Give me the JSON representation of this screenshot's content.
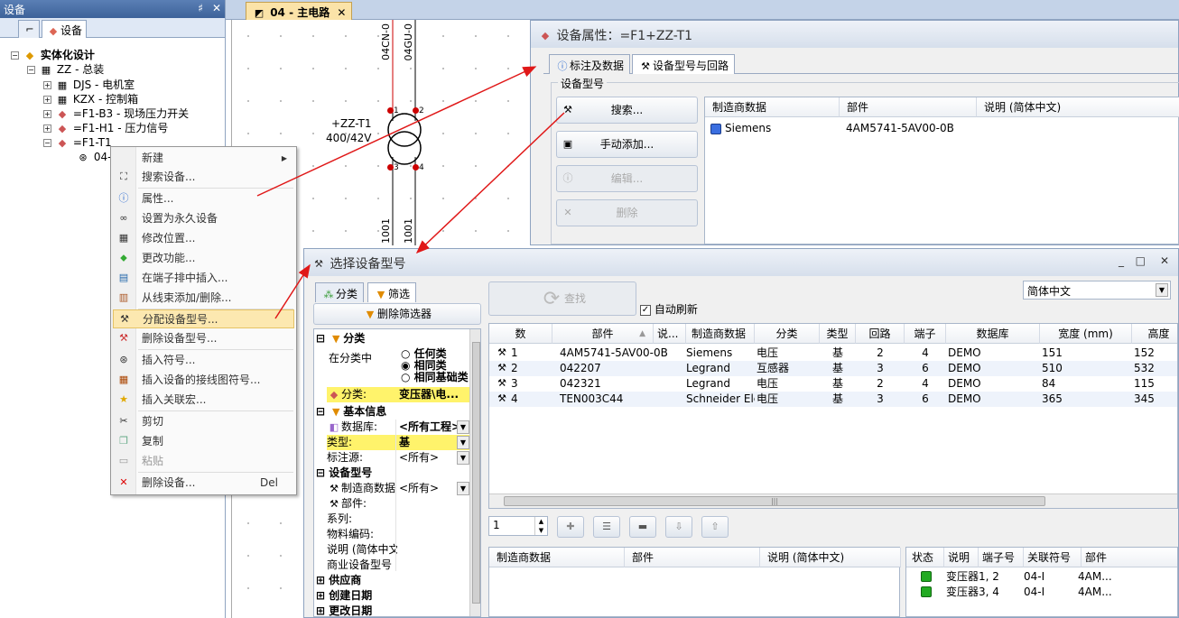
{
  "device_panel": {
    "title": "设备",
    "pin": "♯",
    "close": "✕",
    "tab_label": "设备",
    "tree": [
      {
        "label": "实体化设计",
        "bold": true
      },
      {
        "label": "ZZ - 总装"
      },
      {
        "label": "DJS - 电机室"
      },
      {
        "label": "KZX - 控制箱"
      },
      {
        "label": "=F1-B3 - 现场压力开关"
      },
      {
        "label": "=F1-H1 - 压力信号"
      },
      {
        "label": "=F1-T1"
      },
      {
        "label": "04-"
      }
    ]
  },
  "doc_tab": {
    "label": "04 - 主电路",
    "close": "✕"
  },
  "schematic": {
    "wire1_label": "04CN-0",
    "wire2_label": "04GU-0",
    "wire3_label": "1001",
    "wire4_label": "1001",
    "device_label": "+ZZ-T1",
    "rating": "400/42V",
    "pins": [
      "1",
      "2",
      "3",
      "4"
    ]
  },
  "context_menu": {
    "items": [
      {
        "label": "新建",
        "icon": "blank-icon",
        "arrow": "▶"
      },
      {
        "label": "搜索设备...",
        "icon": "binoculars-icon"
      },
      {
        "label": "属性...",
        "icon": "info-icon"
      },
      {
        "label": "设置为永久设备",
        "icon": "infinity-icon"
      },
      {
        "label": "修改位置...",
        "icon": "location-icon"
      },
      {
        "label": "更改功能...",
        "icon": "function-icon"
      },
      {
        "label": "在端子排中插入...",
        "icon": "terminal-icon"
      },
      {
        "label": "从线束添加/删除...",
        "icon": "harness-icon"
      },
      {
        "label": "分配设备型号...",
        "icon": "tools-icon"
      },
      {
        "label": "删除设备型号...",
        "icon": "tools-delete-icon"
      },
      {
        "label": "插入符号...",
        "icon": "symbol-icon"
      },
      {
        "label": "插入设备的接线图符号...",
        "icon": "wiring-icon"
      },
      {
        "label": "插入关联宏...",
        "icon": "star-icon"
      },
      {
        "label": "剪切",
        "icon": "scissors-icon"
      },
      {
        "label": "复制",
        "icon": "copy-icon"
      },
      {
        "label": "粘贴",
        "icon": "paste-icon"
      },
      {
        "label": "删除设备...",
        "icon": "delete-icon",
        "shortcut": "Del"
      }
    ]
  },
  "prop_window": {
    "title": "设备属性：=F1+ZZ-T1",
    "tab1": "标注及数据",
    "tab2": "设备型号与回路",
    "group_label": "设备型号",
    "btn_search": "搜索...",
    "btn_manual": "手动添加...",
    "btn_edit": "编辑...",
    "btn_delete": "删除",
    "grid_headers": [
      "制造商数据",
      "部件",
      "说明 (简体中文)"
    ],
    "rows": [
      {
        "mfr": "Siemens",
        "part": "4AM5741-5AV00-0B"
      }
    ]
  },
  "sel_window": {
    "title": "选择设备型号",
    "win_buttons": [
      "_",
      "□",
      "✕"
    ],
    "tab_classify": "分类",
    "tab_filter": "筛选",
    "btn_clear_filter": "删除筛选器",
    "btn_find": "查找",
    "auto_refresh": "自动刷新",
    "language": "简体中文",
    "filter": {
      "sec_class": "分类",
      "in_class": "在分类中",
      "radio_any": "任何类",
      "radio_same": "相同类",
      "radio_base": "相同基础类",
      "class_label": "分类:",
      "class_value": "变压器\\电...",
      "sec_basic": "基本信息",
      "db_label": "数据库:",
      "db_value": "<所有工程>",
      "type_label": "类型:",
      "type_value": "基",
      "annot_label": "标注源:",
      "annot_value": "<所有>",
      "sec_model": "设备型号",
      "mfr_label": "制造商数据",
      "mfr_value": "<所有>",
      "part_label": "部件:",
      "series_label": "系列:",
      "material_label": "物料编码:",
      "desc_label": "说明 (简体中文",
      "commercial_label": "商业设备型号",
      "sec_supplier": "供应商",
      "sec_created": "创建日期",
      "sec_modified": "更改日期"
    },
    "result_headers": [
      "数",
      "部件",
      "说...",
      "制造商数据",
      "分类",
      "类型",
      "回路",
      "端子",
      "数据库",
      "宽度 (mm)",
      "高度"
    ],
    "results": [
      {
        "n": "1",
        "part": "4AM5741-5AV00-0B",
        "mfr": "Siemens",
        "cls": "电压",
        "type": "基",
        "circ": "2",
        "term": "4",
        "db": "DEMO",
        "w": "151",
        "h": "152"
      },
      {
        "n": "2",
        "part": "042207",
        "mfr": "Legrand",
        "cls": "互感器",
        "type": "基",
        "circ": "3",
        "term": "6",
        "db": "DEMO",
        "w": "510",
        "h": "532"
      },
      {
        "n": "3",
        "part": "042321",
        "mfr": "Legrand",
        "cls": "电压",
        "type": "基",
        "circ": "2",
        "term": "4",
        "db": "DEMO",
        "w": "84",
        "h": "115"
      },
      {
        "n": "4",
        "part": "TEN003C44",
        "mfr": "Schneider Ele...",
        "cls": "电压",
        "type": "基",
        "circ": "3",
        "term": "6",
        "db": "DEMO",
        "w": "365",
        "h": "345"
      }
    ],
    "qty": "1",
    "lower_headers": [
      "制造商数据",
      "部件",
      "说明 (简体中文)"
    ],
    "status_headers": [
      "状态",
      "说明",
      "端子号",
      "关联符号",
      "部件"
    ],
    "status_rows": [
      {
        "desc": "变压器1, 2",
        "sym": "04-I",
        "part": "4AM..."
      },
      {
        "desc": "变压器3, 4",
        "sym": "04-I",
        "part": "4AM..."
      }
    ]
  }
}
